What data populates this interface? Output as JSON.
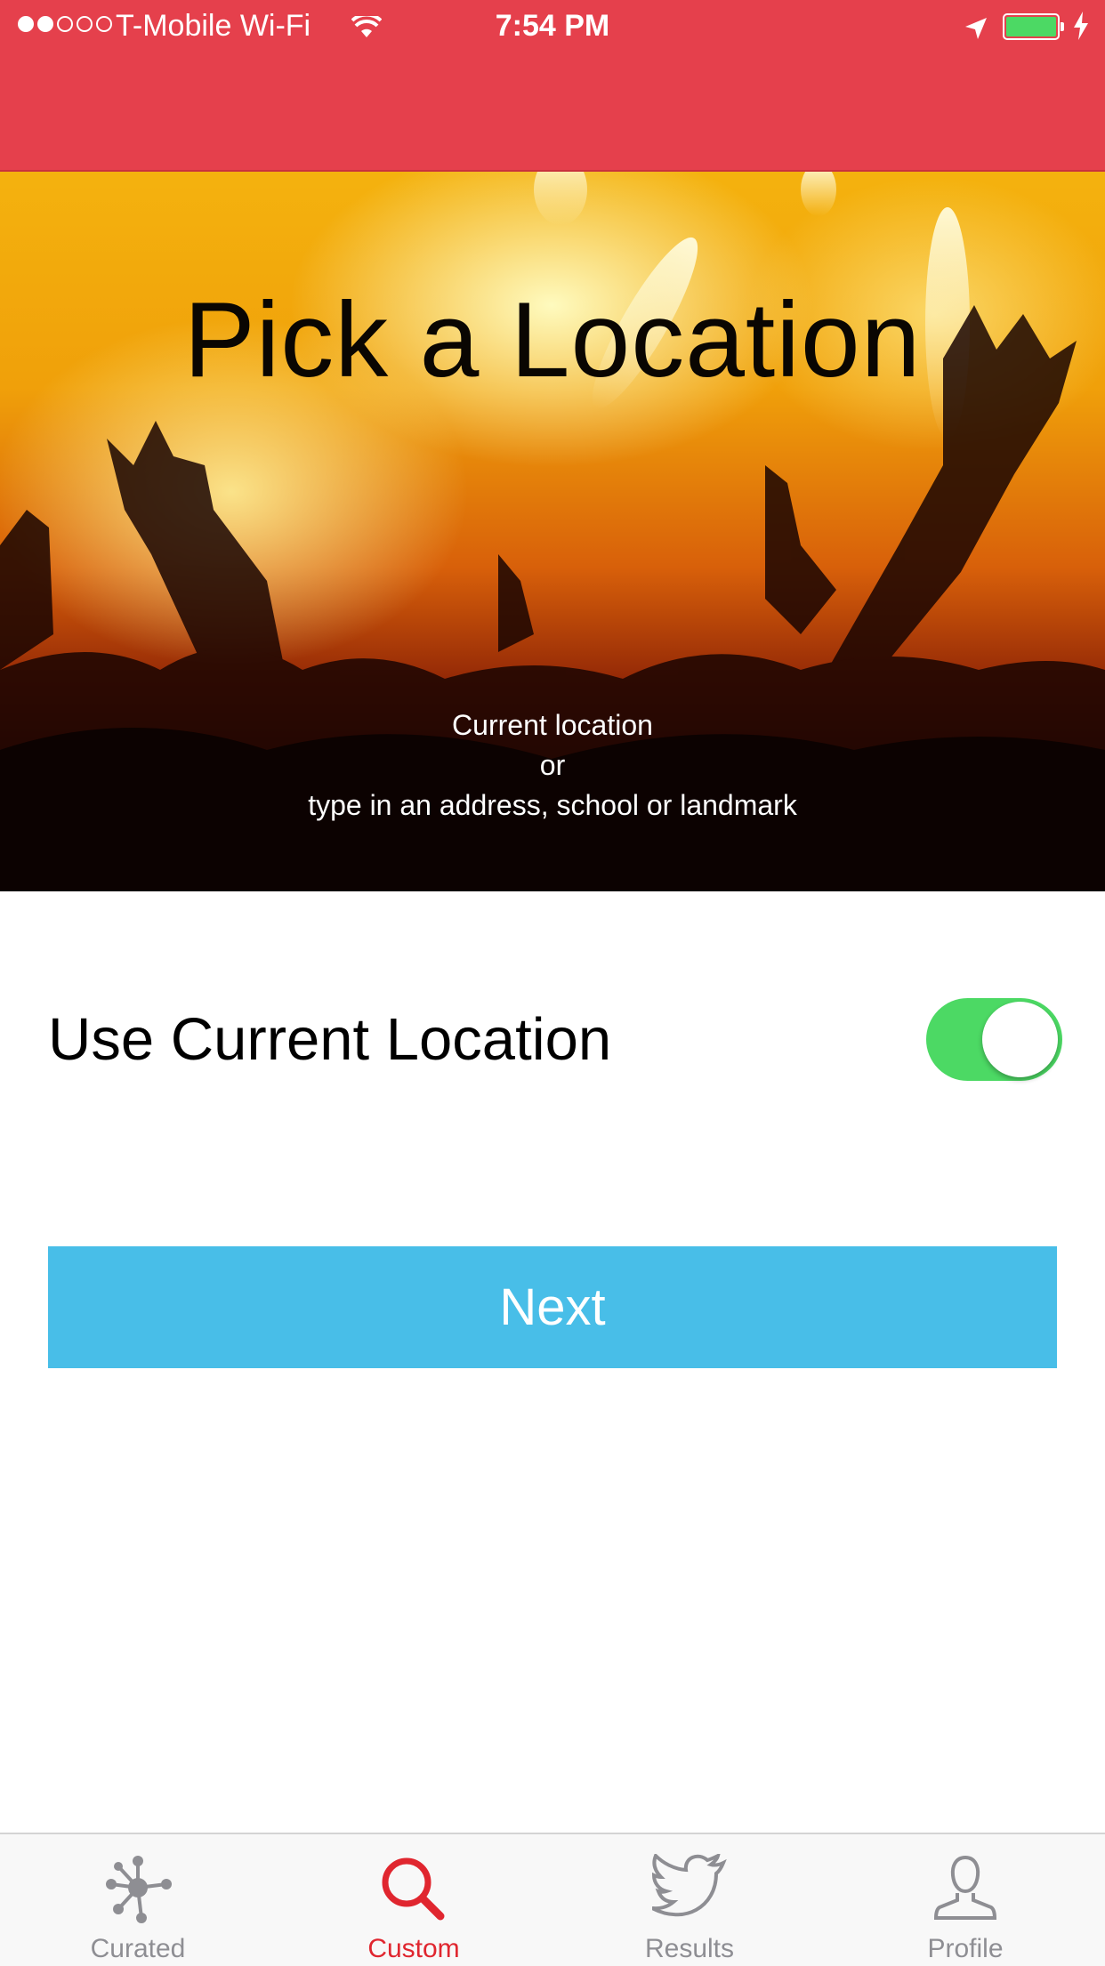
{
  "status_bar": {
    "carrier": "T-Mobile Wi-Fi",
    "time": "7:54 PM",
    "signal_bars_filled": 2,
    "signal_bars_total": 5,
    "battery_fraction": 1.0
  },
  "colors": {
    "header": "#e5404c",
    "toggle_on": "#4cd964",
    "next_button": "#48bee8",
    "tab_active": "#e0262f",
    "tab_inactive": "#8e8e93"
  },
  "hero": {
    "title": "Pick a Location",
    "subtitle_line1": "Current location",
    "subtitle_line2": "or",
    "subtitle_line3": "type in an address, school or landmark"
  },
  "location_toggle": {
    "label": "Use Current Location",
    "on": true
  },
  "next_button": {
    "label": "Next"
  },
  "tabs": [
    {
      "label": "Curated",
      "icon": "network-icon",
      "active": false
    },
    {
      "label": "Custom",
      "icon": "search-icon",
      "active": true
    },
    {
      "label": "Results",
      "icon": "twitter-bird-icon",
      "active": false
    },
    {
      "label": "Profile",
      "icon": "person-icon",
      "active": false
    }
  ]
}
